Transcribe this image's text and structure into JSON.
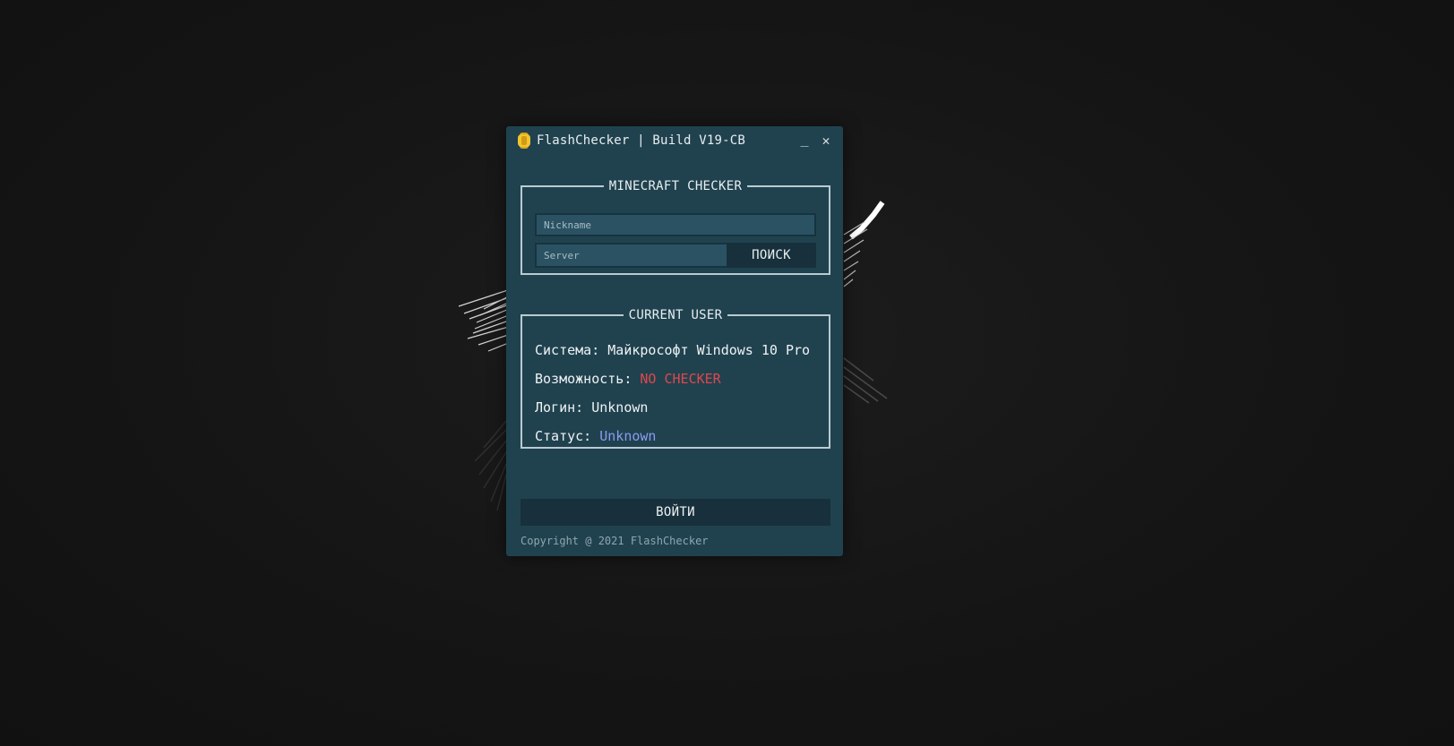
{
  "window": {
    "title": "FlashChecker | Build V19-CB",
    "minimize_label": "_",
    "close_label": "✕",
    "logo_icon": "coin-icon"
  },
  "checker": {
    "heading": "MINECRAFT CHECKER",
    "nickname_placeholder": "Nickname",
    "nickname_value": "",
    "server_placeholder": "Server",
    "server_value": "",
    "search_label": "ПОИСК"
  },
  "current_user": {
    "heading": "CURRENT USER",
    "system_label": "Система:",
    "system_value": "Майкрософт Windows 10 Pro",
    "ability_label": "Возможность:",
    "ability_value": "NO CHECKER",
    "login_label": "Логин:",
    "login_value": "Unknown",
    "status_label": "Статус:",
    "status_value": "Unknown"
  },
  "login_button_label": "ВОЙТИ",
  "footer": {
    "copyright": "Copyright @ 2021 FlashChecker"
  },
  "colors": {
    "window_bg": "#20424f",
    "ability_value": "#e0474c",
    "status_value": "#8a9bf0",
    "desktop_bg": "#141414"
  }
}
